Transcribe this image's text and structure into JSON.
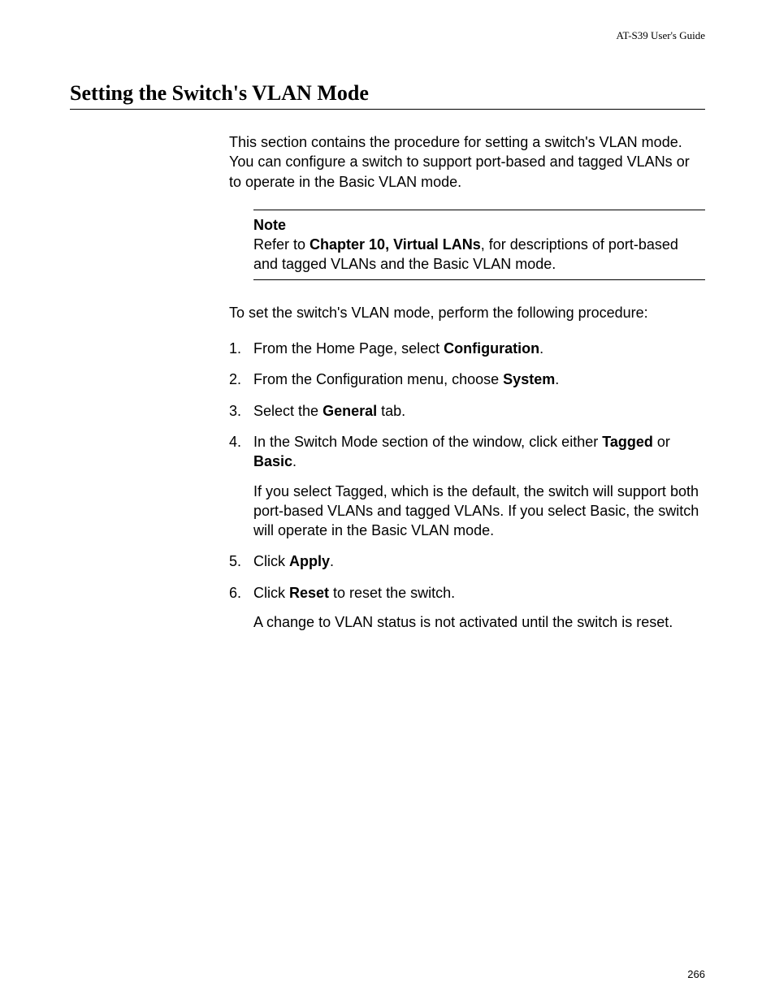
{
  "header": "AT-S39 User's Guide",
  "title": "Setting the Switch's VLAN Mode",
  "intro": "This section contains the procedure for setting a switch's VLAN mode. You can configure a switch to support port-based and tagged VLANs or to operate in the Basic VLAN mode.",
  "note": {
    "label": "Note",
    "pre": "Refer to ",
    "bold": "Chapter 10, Virtual LANs",
    "post": ", for descriptions of port-based and tagged VLANs and the Basic VLAN mode."
  },
  "lead_in": "To set the switch's VLAN mode, perform the following procedure:",
  "steps": {
    "s1": {
      "pre": "From the Home Page, select ",
      "b1": "Configuration",
      "post": "."
    },
    "s2": {
      "pre": "From the Configuration menu, choose ",
      "b1": "System",
      "post": "."
    },
    "s3": {
      "pre": "Select the ",
      "b1": "General",
      "post": " tab."
    },
    "s4": {
      "pre": "In the Switch Mode section of the window, click either ",
      "b1": "Tagged",
      "mid": " or ",
      "b2": "Basic",
      "post": ".",
      "sub": "If you select Tagged, which is the default, the switch will support both port-based VLANs and tagged VLANs. If you select Basic, the switch will operate in the Basic VLAN mode."
    },
    "s5": {
      "pre": "Click ",
      "b1": "Apply",
      "post": "."
    },
    "s6": {
      "pre": "Click ",
      "b1": "Reset",
      "post": " to reset the switch.",
      "sub": "A change to VLAN status is not activated until the switch is reset."
    }
  },
  "page_number": "266"
}
